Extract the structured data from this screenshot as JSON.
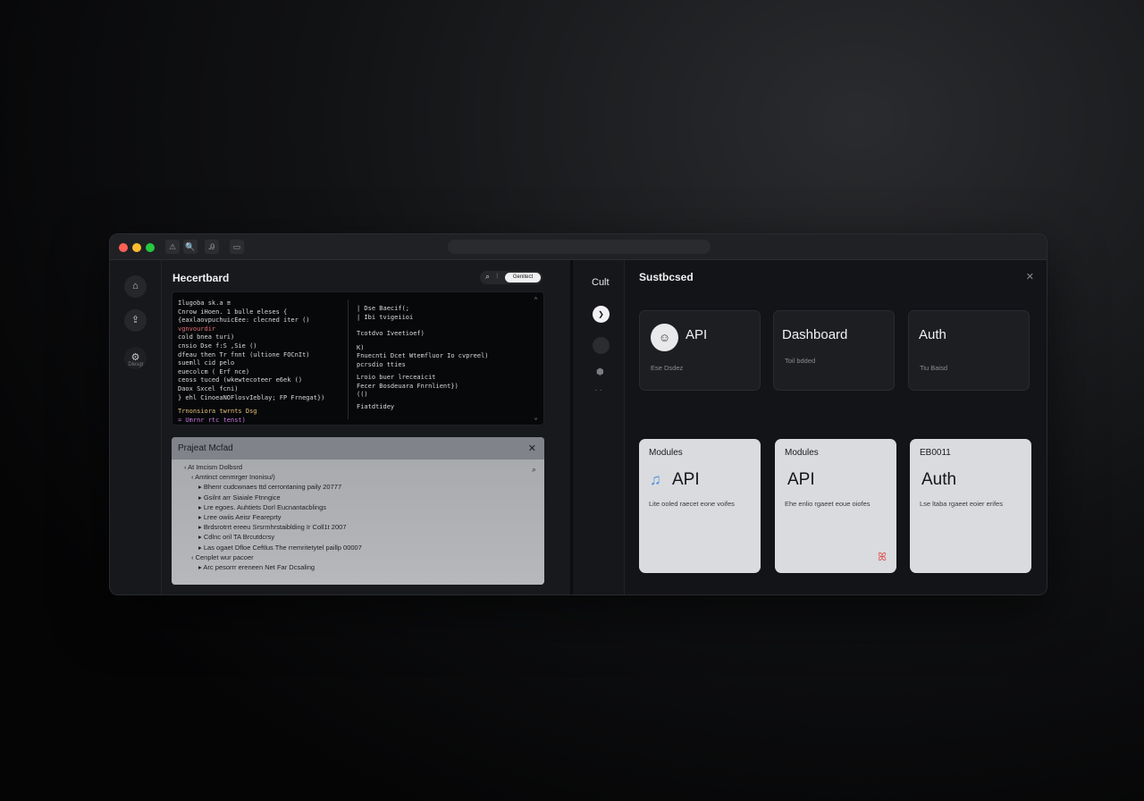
{
  "colors": {
    "accent_red": "#ff5f57",
    "accent_yellow": "#febc2e",
    "accent_green": "#28c840",
    "note_icon": "#4a90d9",
    "badge_icon": "#e0504a"
  },
  "titlebar": {
    "icons": [
      "warning-icon",
      "search-icon",
      "font-icon",
      "folder-icon"
    ],
    "icon_glyphs": [
      "⚠",
      "🔍",
      "Ꭿ",
      "▭"
    ]
  },
  "rail": {
    "items": [
      {
        "icon": "home-icon",
        "glyph": "⌂"
      },
      {
        "icon": "upload-icon",
        "glyph": "⇪"
      },
      {
        "icon": "settings-icon",
        "glyph": "⚙",
        "label": "Dlesgr"
      }
    ]
  },
  "left_pane": {
    "title": "Hecertbard",
    "search_icon": "⌕",
    "search_sep": "⁝",
    "button_label": "Genitect",
    "code_left": [
      {
        "text": "Ilugoba sk.a  ≡",
        "color": "#d9d9dc"
      },
      {
        "text": " Cnrow iHoen.  1 bulle eleses {",
        "color": "#d9d9dc"
      },
      {
        "text": "   {eaxlaovpuchuicEee: clecned iter ()",
        "color": "#d9d9dc"
      },
      {
        "text": "    vgnvourdir",
        "color": "#e06c75"
      },
      {
        "text": "     cold    bnea turi)",
        "color": "#d9d9dc"
      },
      {
        "text": "     cnsio  Dse  f:S   ,Sie ()",
        "color": "#d9d9dc"
      },
      {
        "text": "     dfeau  then   Tr   fnnt (ultione FOCnIt)",
        "color": "#d9d9dc"
      },
      {
        "text": "     suemll   cid pelo",
        "color": "#d9d9dc"
      },
      {
        "text": "     euecolcm  (   Erf   nce)",
        "color": "#d9d9dc"
      },
      {
        "text": "     ceoss  tuced (wkewtecoteer e6ek ()",
        "color": "#d9d9dc"
      },
      {
        "text": "     Daox   Sxcel fcni)",
        "color": "#d9d9dc"
      },
      {
        "text": "  }   ehl CinoeaNOFlosvIeblay; FP Frnegat})",
        "color": "#d9d9dc"
      },
      {
        "text": "  Trnonsiora  twrnts Dsg",
        "color": "#e5c07b"
      },
      {
        "text": "  = Umrnr   rtc  tenst)",
        "color": "#c678dd"
      }
    ],
    "code_right": [
      {
        "text": "|  Dse Baecif(;",
        "color": "#d9d9dc"
      },
      {
        "text": "|  Ibi tvigeiioi",
        "color": "#d9d9dc"
      },
      {
        "text": "Tcotdvo Iveetioef)",
        "color": "#d9d9dc"
      },
      {
        "text": "K)",
        "color": "#d9d9dc"
      },
      {
        "text": "Fnuecnti  Dcet  Wtemfluor  Io  cvpreel)",
        "color": "#d9d9dc"
      },
      {
        "text": "pcrsdio  tties",
        "color": "#d9d9dc"
      },
      {
        "text": "Lroio  buer  lreceaicit",
        "color": "#d9d9dc"
      },
      {
        "text": "Fecer   Bosdeuara  Fnrnlient})",
        "color": "#d9d9dc"
      },
      {
        "text": "(()",
        "color": "#d9d9dc"
      },
      {
        "text": "Fiatdtidey",
        "color": "#d9d9dc"
      }
    ],
    "project": {
      "title": "Prajeat Mcfad",
      "tree": [
        {
          "text": "‹ At Imcism Dolbsrd",
          "indent": 0
        },
        {
          "text": "‹ Amtinct cenmrger Inonisu/)",
          "indent": 1
        },
        {
          "text": "▸ Bhenr cudcwnaes ttd cerrontaning paily 20777",
          "indent": 2
        },
        {
          "text": "▸ Gsilnt arr  Siaiale Ftnngice",
          "indent": 2
        },
        {
          "text": "▸ Lre egoes. Auhtiets Dorl Eucnantacblings",
          "indent": 2
        },
        {
          "text": "▸ Lree owiis Aeisr Feareprty",
          "indent": 2
        },
        {
          "text": "▸ Brdsrotrrt ereeu Srsrmhrstaiblding Ir Coll1t 2007",
          "indent": 2
        },
        {
          "text": "▸ Cdlnc oril TA Brcutdcrsy",
          "indent": 2
        },
        {
          "text": "▸ Las ogaet  Dfloe Ceftlus The rremritetytel paillp 00007",
          "indent": 2
        },
        {
          "text": "‹ Cenplet wur pacoer",
          "indent": 1
        },
        {
          "text": "▸ Arc pesorrr ereneen Net Far Dcsaling",
          "indent": 2
        }
      ]
    }
  },
  "right_rail": {
    "title": "Cult",
    "active_glyph": "❯",
    "icon_glyph": "⬢",
    "mini": "⁃ ⁃"
  },
  "right_pane": {
    "title": "Sustbcsed",
    "close_glyph": "✕",
    "top_cards": [
      {
        "title": "API",
        "sub": "Ese Dsdez",
        "has_avatar": true,
        "avatar_glyph": "☺"
      },
      {
        "title": "Dashboard",
        "sub": "Toil bdded",
        "has_avatar": false
      },
      {
        "title": "Auth",
        "sub": "Tiu Baisd",
        "has_avatar": false
      }
    ],
    "bottom_cards": [
      {
        "label": "Modules",
        "title": "API",
        "desc": "Lite ooled raecet eone voifes",
        "has_note": true,
        "note_glyph": "♫"
      },
      {
        "label": "Modules",
        "title": "API",
        "desc": "Ehe enlio rgaeet eoue oiofes",
        "has_badge": true,
        "badge_glyph": "ꕤ"
      },
      {
        "label": "EB0011",
        "title": "Auth",
        "desc": "Lse ltaba rgaeet eoier erifes"
      }
    ]
  }
}
